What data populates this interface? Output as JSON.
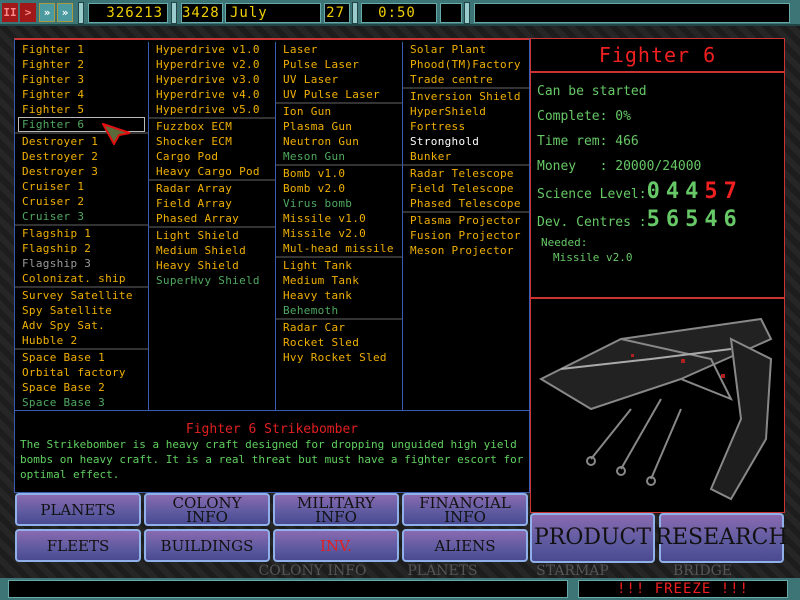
{
  "topbar": {
    "buttons": [
      {
        "name": "pause",
        "glyph": "II",
        "color": "#c02020"
      },
      {
        "name": "play",
        "glyph": ">",
        "color": "#c02020"
      },
      {
        "name": "fast",
        "glyph": "»",
        "color": "#4a9aa0"
      },
      {
        "name": "fastest",
        "glyph": "»",
        "color": "#4a9aa0"
      }
    ],
    "money": "326213",
    "year": "3428",
    "month": "July",
    "day": "27",
    "time": "0:50"
  },
  "colors": {
    "available": "#f0b000",
    "researchable": "#4fa860",
    "locked": "#9a9a9a",
    "special": "#ffffff",
    "title_red": "#f02020",
    "info_green": "#66c866"
  },
  "columns": [
    [
      [
        [
          "Fighter 1",
          "y"
        ],
        [
          "Fighter 2",
          "y"
        ],
        [
          "Fighter 3",
          "y"
        ],
        [
          "Fighter 4",
          "y"
        ],
        [
          "Fighter 5",
          "y"
        ],
        [
          "Fighter 6",
          "g"
        ]
      ],
      [
        [
          "Destroyer 1",
          "y"
        ],
        [
          "Destroyer 2",
          "y"
        ],
        [
          "Destroyer 3",
          "y"
        ],
        [
          "Cruiser 1",
          "y"
        ],
        [
          "Cruiser 2",
          "y"
        ],
        [
          "Cruiser 3",
          "g"
        ]
      ],
      [
        [
          "Flagship 1",
          "y"
        ],
        [
          "Flagship 2",
          "y"
        ],
        [
          "Flagship 3",
          "x"
        ],
        [
          "Colonizat. ship",
          "y"
        ]
      ],
      [
        [
          "Survey Satellite",
          "y"
        ],
        [
          "Spy Satellite",
          "y"
        ],
        [
          "Adv Spy Sat.",
          "y"
        ],
        [
          "Hubble 2",
          "y"
        ]
      ],
      [
        [
          "Space Base 1",
          "y"
        ],
        [
          "Orbital factory",
          "y"
        ],
        [
          "Space Base 2",
          "y"
        ],
        [
          "Space Base 3",
          "g"
        ]
      ]
    ],
    [
      [
        [
          "Hyperdrive v1.0",
          "y"
        ],
        [
          "Hyperdrive v2.0",
          "y"
        ],
        [
          "Hyperdrive v3.0",
          "y"
        ],
        [
          "Hyperdrive v4.0",
          "y"
        ],
        [
          "Hyperdrive v5.0",
          "y"
        ]
      ],
      [
        [
          "Fuzzbox ECM",
          "y"
        ],
        [
          "Shocker ECM",
          "y"
        ],
        [
          "Cargo Pod",
          "y"
        ],
        [
          "Heavy Cargo Pod",
          "y"
        ]
      ],
      [
        [
          "Radar Array",
          "y"
        ],
        [
          "Field Array",
          "y"
        ],
        [
          "Phased Array",
          "y"
        ]
      ],
      [
        [
          "Light Shield",
          "y"
        ],
        [
          "Medium Shield",
          "y"
        ],
        [
          "Heavy Shield",
          "y"
        ],
        [
          "SuperHvy Shield",
          "g"
        ]
      ]
    ],
    [
      [
        [
          "Laser",
          "y"
        ],
        [
          "Pulse Laser",
          "y"
        ],
        [
          "UV Laser",
          "y"
        ],
        [
          "UV Pulse Laser",
          "y"
        ]
      ],
      [
        [
          "Ion Gun",
          "y"
        ],
        [
          "Plasma Gun",
          "y"
        ],
        [
          "Neutron Gun",
          "y"
        ],
        [
          "Meson Gun",
          "g"
        ]
      ],
      [
        [
          "Bomb v1.0",
          "y"
        ],
        [
          "Bomb v2.0",
          "y"
        ],
        [
          "Virus bomb",
          "g"
        ],
        [
          "Missile v1.0",
          "y"
        ],
        [
          "Missile v2.0",
          "y"
        ],
        [
          "Mul-head missile",
          "y"
        ]
      ],
      [
        [
          "Light Tank",
          "y"
        ],
        [
          "Medium Tank",
          "y"
        ],
        [
          "Heavy tank",
          "y"
        ],
        [
          "Behemoth",
          "g"
        ]
      ],
      [
        [
          "Radar Car",
          "y"
        ],
        [
          "Rocket Sled",
          "y"
        ],
        [
          "Hvy Rocket Sled",
          "y"
        ]
      ]
    ],
    [
      [
        [
          "Solar Plant",
          "y"
        ],
        [
          "Phood(TM)Factory",
          "y"
        ],
        [
          "Trade centre",
          "y"
        ]
      ],
      [
        [
          "Inversion Shield",
          "y"
        ],
        [
          "HyperShield",
          "y"
        ],
        [
          "Fortress",
          "y"
        ],
        [
          "Stronghold",
          "w"
        ],
        [
          "Bunker",
          "y"
        ]
      ],
      [
        [
          "Radar Telescope",
          "y"
        ],
        [
          "Field Telescope",
          "y"
        ],
        [
          "Phased Telescope",
          "y"
        ]
      ],
      [
        [
          "Plasma Projector",
          "y"
        ],
        [
          "Fusion Projector",
          "y"
        ],
        [
          "Meson Projector",
          "y"
        ]
      ]
    ]
  ],
  "selected": "Fighter 6",
  "description": {
    "title": "Fighter 6 Strikebomber",
    "text": "The Strikebomber is a heavy craft designed for dropping unguided high yield bombs on heavy craft. It is a real threat but must have a fighter escort for optimal effect."
  },
  "nav": {
    "planets": "PLANETS",
    "colony_1": "COLONY",
    "colony_2": "INFO",
    "military_1": "MILITARY",
    "military_2": "INFO",
    "financial_1": "FINANCIAL",
    "financial_2": "INFO",
    "fleets": "FLEETS",
    "buildings": "BUILDINGS",
    "inv": "INV.",
    "aliens": "ALIENS",
    "product": "PRODUCT",
    "research": "RESEARCH"
  },
  "info": {
    "title": "Fighter 6",
    "status": "Can be started",
    "complete_label": "Complete:",
    "complete": "0%",
    "time_label": "Time rem:",
    "time": "466",
    "money_label": "Money   :",
    "money": "20000/24000",
    "science_label": "Science Level:",
    "science_ok": "044",
    "science_short": "57",
    "dev_label": "Dev. Centres :",
    "dev": "56546",
    "needed_label": "Needed:",
    "needed": "Missile v2.0"
  },
  "background_buttons": [
    "COLONY INFO",
    "PLANETS",
    "STARMAP",
    "BRIDGE"
  ],
  "statusbar": {
    "message": "!!! FREEZE !!!"
  }
}
